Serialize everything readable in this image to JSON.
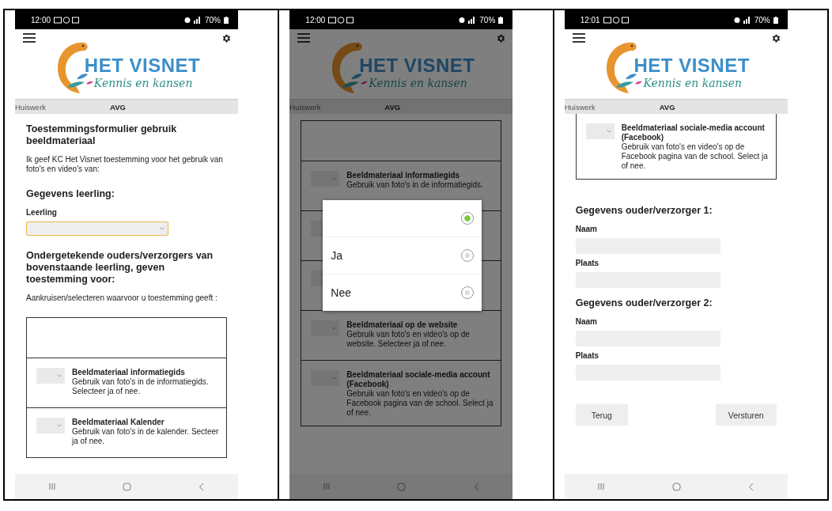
{
  "screens": [
    {
      "status_bar": {
        "time": "12:00",
        "battery": "70%"
      },
      "logo": {
        "title": "HET VISNET",
        "tagline": "Kennis en kansen"
      },
      "tabs": [
        {
          "label": "Huiswerk",
          "selected": false
        },
        {
          "label": "AVG",
          "selected": true
        }
      ],
      "dimmed": false,
      "content": [
        {
          "kind": "heading",
          "text": "Toestemmingsformulier gebruik beeldmateriaal"
        },
        {
          "kind": "text",
          "text": "Ik geef KC Het Visnet toestemming voor het gebruik van foto's en video's van:"
        },
        {
          "kind": "heading",
          "text": "Gegevens leerling:"
        },
        {
          "kind": "label",
          "text": "Leerling"
        },
        {
          "kind": "select",
          "focused": true
        },
        {
          "kind": "heading",
          "text": "Ondergetekende ouders/verzorgers van bovenstaande leerling, geven toestemming voor:"
        },
        {
          "kind": "text",
          "text": "Aankruisen/selecteren waarvoor u toestemming geeft :"
        },
        {
          "kind": "table",
          "continued": false,
          "rows": [
            {
              "title": "Beeldmateriaal informatiegids",
              "description": "Gebruik van foto's in de informatiegids. Selecteer ja of nee."
            },
            {
              "title": "Beeldmateriaal Kalender",
              "description": "Gebruik van foto's in de kalender. Secteer ja of nee."
            }
          ]
        }
      ]
    },
    {
      "status_bar": {
        "time": "12:00",
        "battery": "70%"
      },
      "logo": {
        "title": "HET VISNET",
        "tagline": "Kennis en kansen"
      },
      "tabs": [
        {
          "label": "Huiswerk",
          "selected": false
        },
        {
          "label": "AVG",
          "selected": true
        }
      ],
      "dimmed": true,
      "content": [
        {
          "kind": "table",
          "continued": false,
          "rows": [
            {
              "title": "Beeldmateriaal informatiegids",
              "description": "Gebruik van foto's in de informatiegids."
            },
            {},
            {},
            {
              "title": "Beeldmateriaal op de website",
              "description": "Gebruik van foto's en video's op de website. Selecteer ja of nee."
            },
            {
              "title": "Beeldmateriaal sociale-media account (Facebook)",
              "description": "Gebruik van foto's en video's op de Facebook pagina van de school. Select ja of nee."
            }
          ]
        }
      ],
      "dialog": {
        "options": [
          {
            "selected": true
          },
          {
            "label": "Ja",
            "selected": false
          },
          {
            "label": "Nee",
            "selected": false
          }
        ]
      }
    },
    {
      "status_bar": {
        "time": "12:01",
        "battery": "70%"
      },
      "logo": {
        "title": "HET VISNET",
        "tagline": "Kennis en kansen"
      },
      "tabs": [
        {
          "label": "Huiswerk",
          "selected": false
        },
        {
          "label": "AVG",
          "selected": true
        }
      ],
      "dimmed": false,
      "content": [
        {
          "kind": "table",
          "continued": true,
          "rows": [
            {
              "title": "Beeldmateriaal sociale-media account (Facebook)",
              "description": "Gebruik van foto's en video's op de Facebook pagina van de school. Select ja of nee."
            }
          ]
        },
        {
          "kind": "heading",
          "text": "Gegevens ouder/verzorger 1:"
        },
        {
          "kind": "label",
          "text": "Naam"
        },
        {
          "kind": "field"
        },
        {
          "kind": "label",
          "text": "Plaats"
        },
        {
          "kind": "field"
        },
        {
          "kind": "heading",
          "text": "Gegevens ouder/verzorger 2:"
        },
        {
          "kind": "label",
          "text": "Naam"
        },
        {
          "kind": "field"
        },
        {
          "kind": "label",
          "text": "Plaats"
        },
        {
          "kind": "field"
        },
        {
          "kind": "buttons",
          "buttons": [
            {
              "label": "Terug"
            },
            {
              "label": "Versturen"
            }
          ]
        }
      ]
    }
  ]
}
